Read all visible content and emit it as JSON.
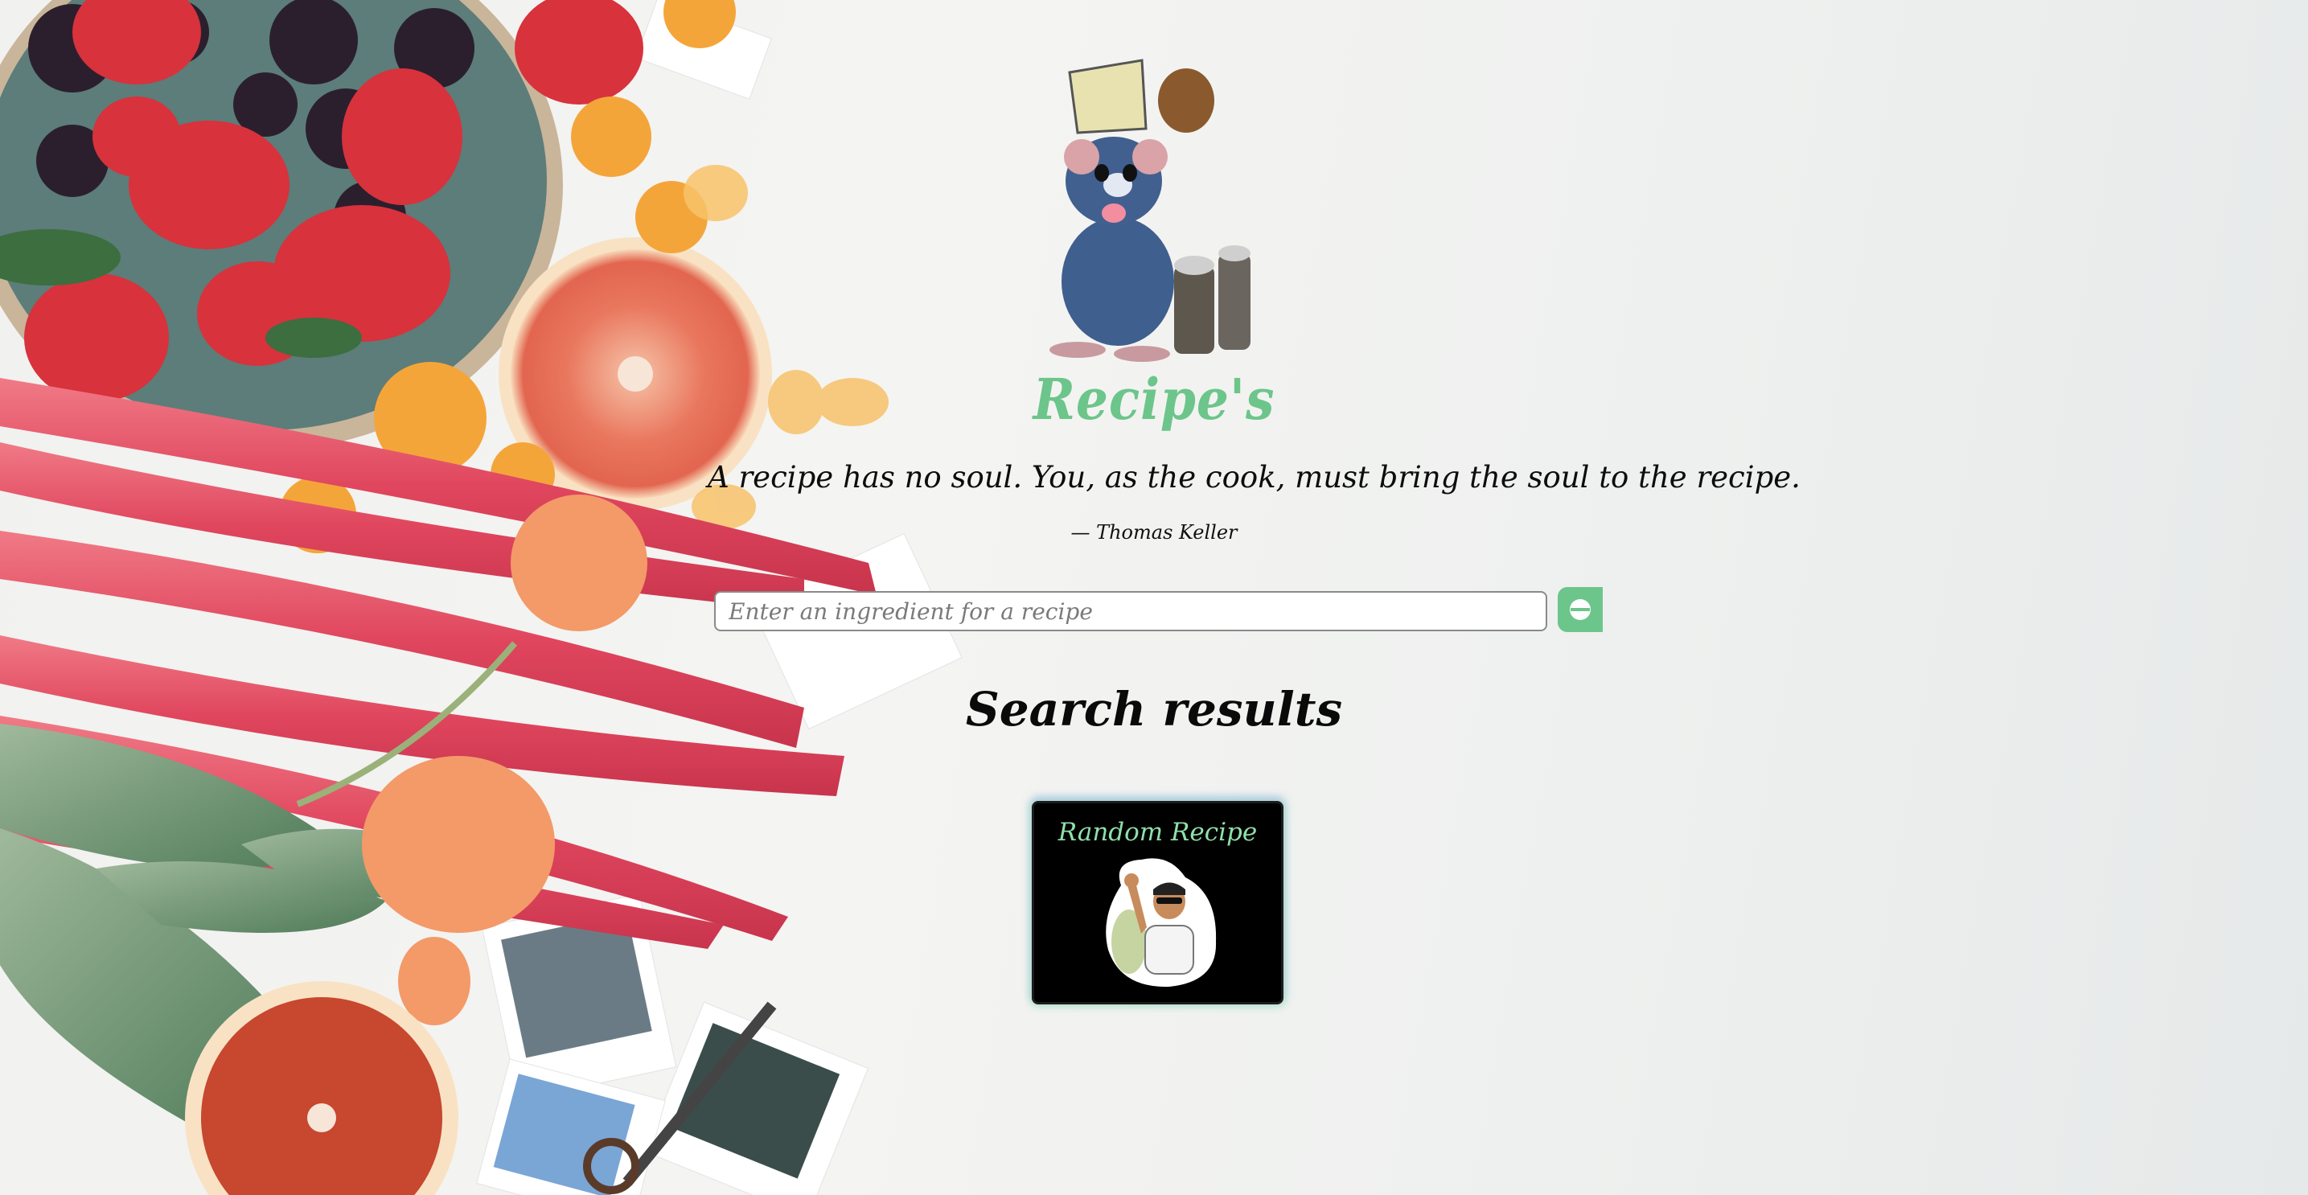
{
  "app": {
    "title": "Recipe's"
  },
  "quote": {
    "text": "A recipe has no soul. You, as the cook, must bring the soul to the recipe.",
    "author": "— Thomas Keller"
  },
  "search": {
    "placeholder": "Enter an ingredient for a recipe",
    "value": "",
    "button_icon": "search-icon"
  },
  "results": {
    "heading": "Search results",
    "cards": [
      {
        "title": "Random Recipe",
        "image": "salt-bae-sticker"
      }
    ]
  },
  "colors": {
    "accent": "#6cc58a",
    "card_title": "#8fe0aa",
    "card_background": "#000000",
    "text": "#0d0d0d"
  }
}
